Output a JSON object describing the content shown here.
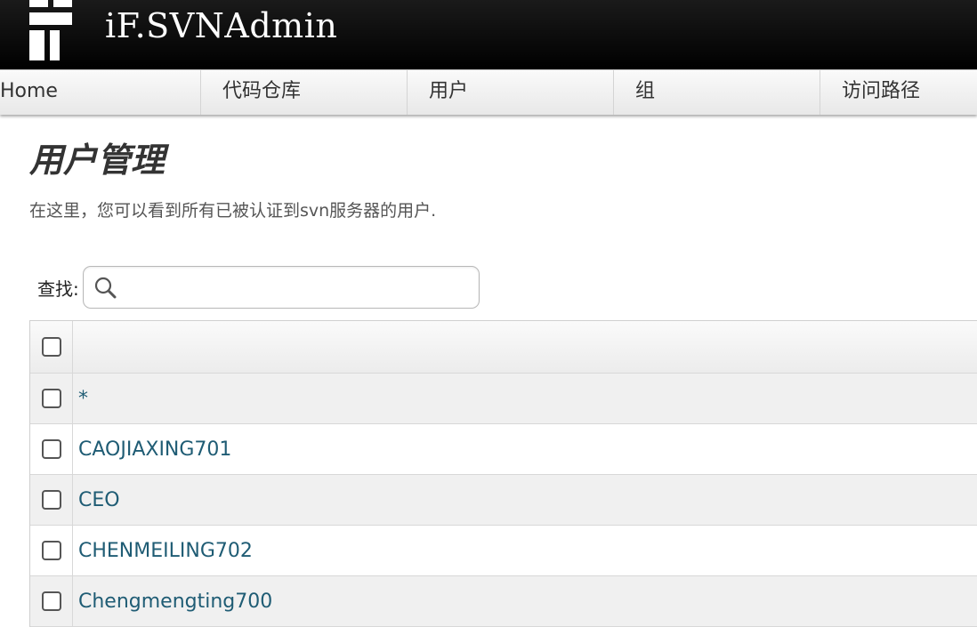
{
  "header": {
    "app_title": "iF.SVNAdmin",
    "logo_icon": "svnadmin-logo-icon"
  },
  "nav": {
    "items": [
      {
        "label": "Home"
      },
      {
        "label": "代码仓库"
      },
      {
        "label": "用户"
      },
      {
        "label": "组"
      },
      {
        "label": "访问路径"
      }
    ]
  },
  "main": {
    "title": "用户管理",
    "description": "在这里，您可以看到所有已被认证到svn服务器的用户."
  },
  "search": {
    "label": "查找:",
    "value": "",
    "placeholder": "",
    "icon": "search-icon"
  },
  "table": {
    "header": "",
    "rows": [
      {
        "name": "*"
      },
      {
        "name": "CAOJIAXING701"
      },
      {
        "name": "CEO"
      },
      {
        "name": "CHENMEILING702"
      },
      {
        "name": "Chengmengting700"
      }
    ]
  },
  "colors": {
    "link": "#1f5c74",
    "header_bg": "#000000",
    "row_alt": "#f0f0f0"
  }
}
